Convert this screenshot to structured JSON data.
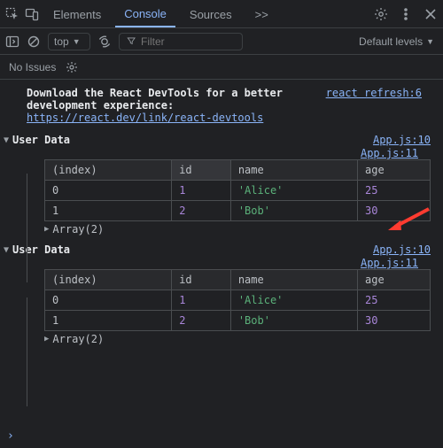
{
  "tabs": {
    "elements": "Elements",
    "console": "Console",
    "sources": "Sources",
    "more": ">>"
  },
  "toolbar": {
    "context": "top",
    "filter_placeholder": "Filter",
    "levels": "Default levels"
  },
  "issues": {
    "label": "No Issues"
  },
  "refresh": {
    "label": "react refresh:6"
  },
  "intro": {
    "line1": "Download the React DevTools for a better",
    "line2": "development experience:",
    "link": "https://react.dev/link/react-devtools"
  },
  "groups": [
    {
      "title": "User Data",
      "link_head": "App.js:10",
      "link_table": "App.js:11",
      "columns": [
        "(index)",
        "id",
        "name",
        "age"
      ],
      "rows": [
        {
          "index": "0",
          "id": "1",
          "name": "'Alice'",
          "age": "25"
        },
        {
          "index": "1",
          "id": "2",
          "name": "'Bob'",
          "age": "30"
        }
      ],
      "array_label": "Array(2)"
    },
    {
      "title": "User Data",
      "link_head": "App.js:10",
      "link_table": "App.js:11",
      "columns": [
        "(index)",
        "id",
        "name",
        "age"
      ],
      "rows": [
        {
          "index": "0",
          "id": "1",
          "name": "'Alice'",
          "age": "25"
        },
        {
          "index": "1",
          "id": "2",
          "name": "'Bob'",
          "age": "30"
        }
      ],
      "array_label": "Array(2)"
    }
  ]
}
